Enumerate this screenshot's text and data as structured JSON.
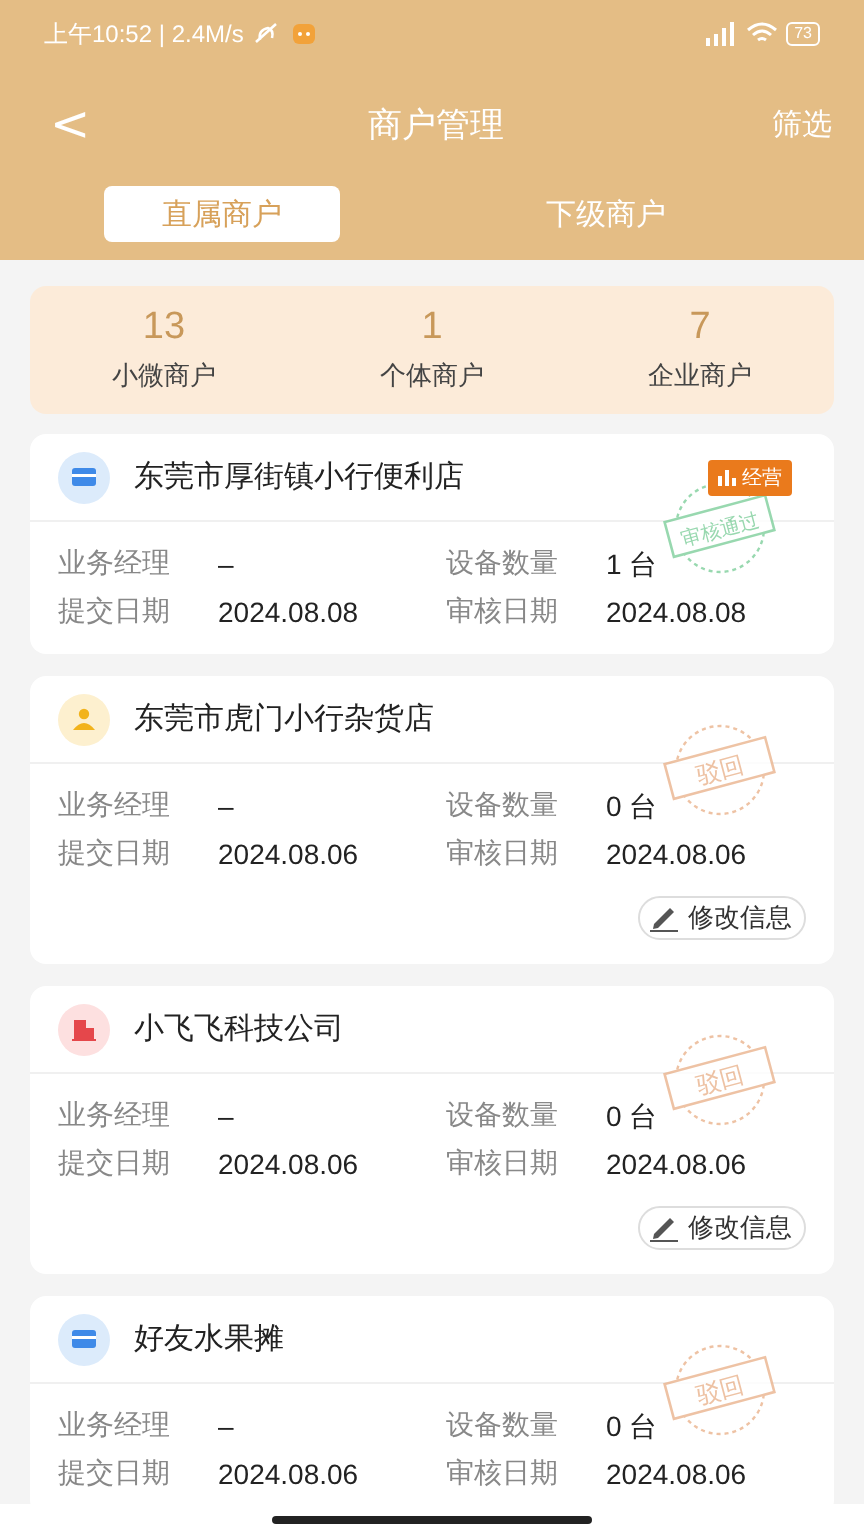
{
  "status_bar": {
    "time": "上午10:52 | 2.4M/s",
    "battery": "73"
  },
  "header": {
    "back": "<",
    "title": "商户管理",
    "action": "筛选"
  },
  "tabs": [
    {
      "label": "直属商户",
      "selected": true
    },
    {
      "label": "下级商户",
      "selected": false
    }
  ],
  "summary": [
    {
      "count": "13",
      "label": "小微商户"
    },
    {
      "count": "1",
      "label": "个体商户"
    },
    {
      "count": "7",
      "label": "企业商户"
    }
  ],
  "merchants": [
    {
      "kind": "store",
      "name": "东莞市厚街镇小行便利店",
      "badge": "经营",
      "stamp": {
        "kind": "approved",
        "text": "审核通过"
      },
      "fields": [
        {
          "label": "业务经理",
          "value": "–"
        },
        {
          "label": "设备数量",
          "value": "1 台"
        },
        {
          "label": "提交日期",
          "value": "2024.08.08"
        },
        {
          "label": "审核日期",
          "value": "2024.08.08"
        }
      ]
    },
    {
      "kind": "person",
      "name": "东莞市虎门小行杂货店",
      "stamp": {
        "kind": "rejected",
        "text": "驳回"
      },
      "fields": [
        {
          "label": "业务经理",
          "value": "–"
        },
        {
          "label": "设备数量",
          "value": "0 台"
        },
        {
          "label": "提交日期",
          "value": "2024.08.06"
        },
        {
          "label": "审核日期",
          "value": "2024.08.06"
        }
      ],
      "edit": "修改信息"
    },
    {
      "kind": "company",
      "name": "小飞飞科技公司",
      "stamp": {
        "kind": "rejected",
        "text": "驳回"
      },
      "fields": [
        {
          "label": "业务经理",
          "value": "–"
        },
        {
          "label": "设备数量",
          "value": "0 台"
        },
        {
          "label": "提交日期",
          "value": "2024.08.06"
        },
        {
          "label": "审核日期",
          "value": "2024.08.06"
        }
      ],
      "edit": "修改信息"
    },
    {
      "kind": "store",
      "name": "好友水果摊",
      "stamp": {
        "kind": "rejected",
        "text": "驳回"
      },
      "fields": [
        {
          "label": "业务经理",
          "value": "–"
        },
        {
          "label": "设备数量",
          "value": "0 台"
        },
        {
          "label": "提交日期",
          "value": "2024.08.06"
        },
        {
          "label": "审核日期",
          "value": "2024.08.06"
        }
      ]
    }
  ]
}
